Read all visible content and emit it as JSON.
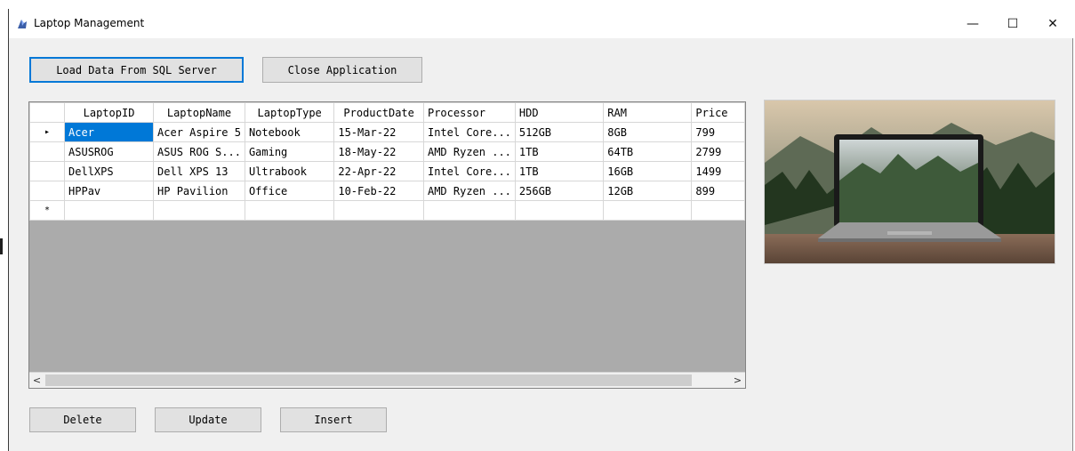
{
  "window": {
    "title": "Laptop Management",
    "controls": {
      "minimize": "—",
      "maximize": "☐",
      "close": "✕"
    }
  },
  "toolbar": {
    "load_label": "Load Data From SQL Server",
    "close_app_label": "Close Application"
  },
  "grid": {
    "columns": [
      "LaptopID",
      "LaptopName",
      "LaptopType",
      "ProductDate",
      "Processor",
      "HDD",
      "RAM",
      "Price"
    ],
    "rows": [
      [
        "Acer",
        "Acer Aspire 5",
        "Notebook",
        "15-Mar-22",
        "Intel Core...",
        "512GB",
        "8GB",
        "799"
      ],
      [
        "ASUSROG",
        "ASUS ROG S...",
        "Gaming",
        "18-May-22",
        "AMD Ryzen ...",
        "1TB",
        "64TB",
        "2799"
      ],
      [
        "DellXPS",
        "Dell XPS 13",
        "Ultrabook",
        "22-Apr-22",
        "Intel Core...",
        "1TB",
        "16GB",
        "1499"
      ],
      [
        "HPPav",
        "HP Pavilion",
        "Office",
        "10-Feb-22",
        "AMD Ryzen ...",
        "256GB",
        "12GB",
        "899"
      ]
    ],
    "current_row_marker": "▸",
    "new_row_marker": "*",
    "scroll_left": "<",
    "scroll_right": ">"
  },
  "actions": {
    "delete_label": "Delete",
    "update_label": "Update",
    "insert_label": "Insert"
  },
  "image": {
    "subject": "laptop-on-table-with-mountain-forest-background"
  },
  "colors": {
    "selection": "#0078d7",
    "grid_background": "#ababab",
    "window_background": "#f0f0f0"
  }
}
